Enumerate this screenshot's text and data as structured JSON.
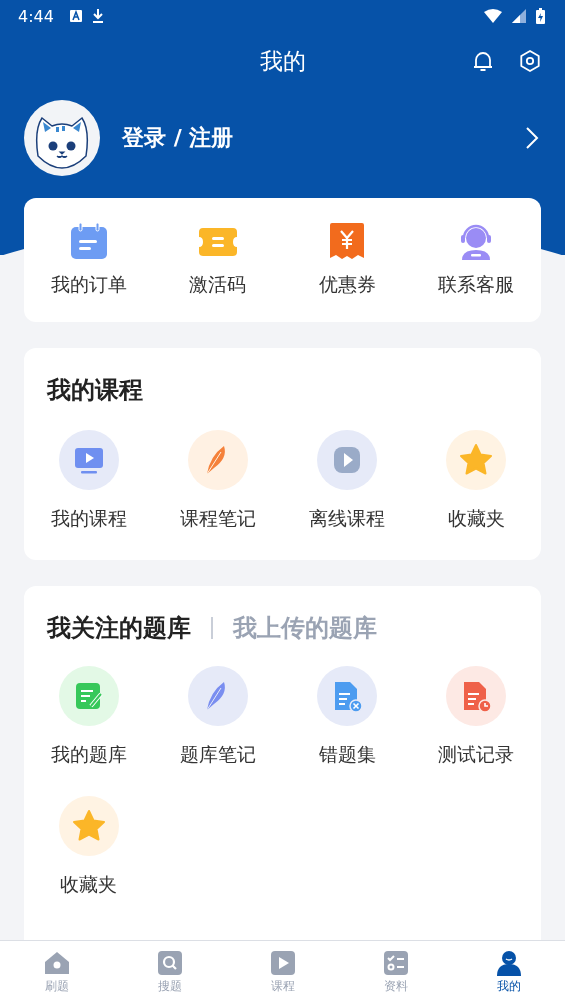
{
  "status_bar": {
    "time": "4:44"
  },
  "header": {
    "title": "我的"
  },
  "user": {
    "login_label": "登录 / 注册"
  },
  "quick_actions": [
    {
      "label": "我的订单"
    },
    {
      "label": "激活码"
    },
    {
      "label": "优惠券"
    },
    {
      "label": "联系客服"
    }
  ],
  "my_courses": {
    "title": "我的课程",
    "items": [
      {
        "label": "我的课程"
      },
      {
        "label": "课程笔记"
      },
      {
        "label": "离线课程"
      },
      {
        "label": "收藏夹"
      }
    ]
  },
  "question_banks": {
    "tabs": [
      {
        "label": "我关注的题库",
        "selected": true
      },
      {
        "label": "我上传的题库",
        "selected": false
      }
    ],
    "items": [
      {
        "label": "我的题库"
      },
      {
        "label": "题库笔记"
      },
      {
        "label": "错题集"
      },
      {
        "label": "测试记录"
      },
      {
        "label": "收藏夹"
      }
    ]
  },
  "bottom_nav": [
    {
      "label": "刷题",
      "selected": false
    },
    {
      "label": "搜题",
      "selected": false
    },
    {
      "label": "课程",
      "selected": false
    },
    {
      "label": "资料",
      "selected": false
    },
    {
      "label": "我的",
      "selected": true
    }
  ]
}
